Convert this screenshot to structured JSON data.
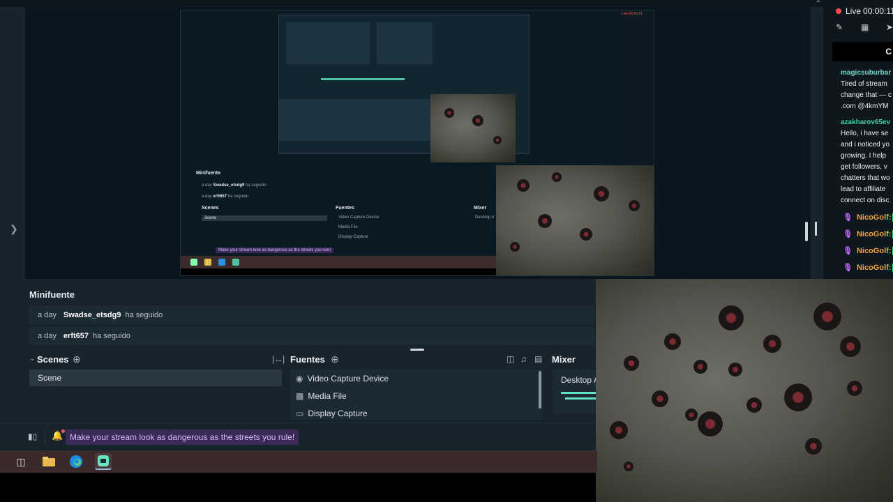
{
  "chat": {
    "status_live": "Live",
    "status_time": "00:00:11",
    "tab_label": "C",
    "messages": [
      {
        "user": "magicsuburbar",
        "lines": [
          "Tired of stream",
          "change that — c",
          ".com @4kmYM"
        ]
      },
      {
        "user": "azakharov65ev",
        "lines": [
          "Hello, i have se",
          "and i noticed yo",
          "growing. I help",
          "get followers, v",
          "chatters that wo",
          "lead to affiliate",
          "connect on disc"
        ]
      }
    ],
    "repeated_user": "NicoGolf",
    "repeated_suffix": ":"
  },
  "minifuente": {
    "title": "Minifuente",
    "rows": [
      {
        "time": "a day",
        "user": "Swadse_etsdg9",
        "action": "ha seguido"
      },
      {
        "time": "a day",
        "user": "erft657",
        "action": "ha seguido"
      }
    ]
  },
  "scenes": {
    "title": "Scenes",
    "items": [
      "Scene"
    ]
  },
  "sources": {
    "title": "Fuentes",
    "items": [
      {
        "label": "Video Capture Device",
        "icon": "camera-icon"
      },
      {
        "label": "Media File",
        "icon": "file-icon"
      },
      {
        "label": "Display Capture",
        "icon": "monitor-icon"
      }
    ]
  },
  "mixer": {
    "title": "Mixer",
    "channel": "Desktop A"
  },
  "footer": {
    "promo": "Make your stream look as dangerous as the streets you rule!"
  },
  "nested": {
    "live": "Live 00:00:11",
    "title": "Minifuente",
    "row1_time": "a day",
    "row1_user": "Swadse_etsdg9",
    "row1_action": "ha seguido",
    "row2_time": "a day",
    "row2_user": "erft657",
    "row2_action": "ha seguido",
    "scenes": "Scenes",
    "scene": "Scene",
    "fuentes": "Fuentes",
    "src1": "Video Capture Device",
    "src2": "Media File",
    "src3": "Display Capture",
    "mixer": "Mixer",
    "mixer_ch": "Desktop A",
    "promo": "Make your stream look as dangerous as the streets you rule!"
  },
  "colors": {
    "app_bg": "#17242d",
    "accent_teal": "#5fe3c0",
    "promo_text": "#d8b6ff",
    "live_red": "#ff4a4a",
    "nico_orange": "#f4a43a"
  }
}
